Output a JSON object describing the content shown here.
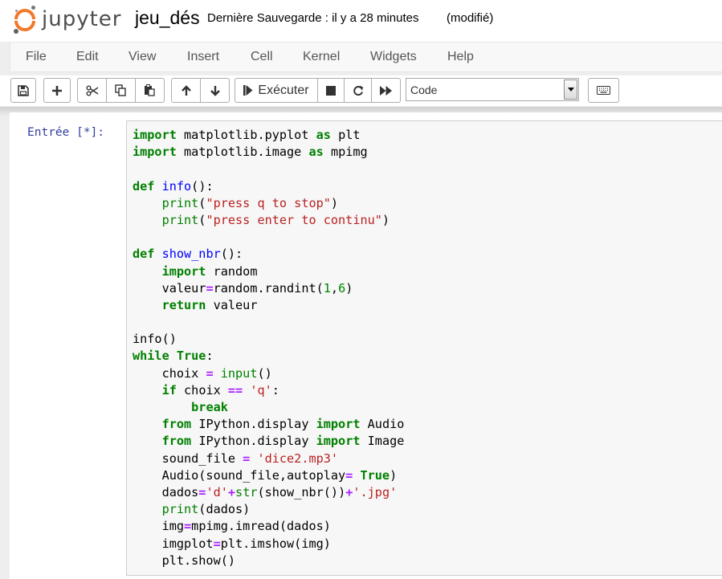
{
  "header": {
    "logo_text": "jupyter",
    "notebook_name": "jeu_dés",
    "save_status": "Dernière Sauvegarde : il y a 28 minutes",
    "dirty_indicator": "(modifié)"
  },
  "menu": [
    "File",
    "Edit",
    "View",
    "Insert",
    "Cell",
    "Kernel",
    "Widgets",
    "Help"
  ],
  "toolbar": {
    "run_label": "Exécuter",
    "cell_type": "Code",
    "icons": [
      "save-icon",
      "plus-icon",
      "scissors-icon",
      "copy-icon",
      "paste-icon",
      "arrow-up-icon",
      "arrow-down-icon",
      "step-forward-icon",
      "stop-icon",
      "restart-icon",
      "fast-forward-icon",
      "keyboard-icon"
    ]
  },
  "cell": {
    "prompt": "Entrée [*]:",
    "lines": [
      [
        [
          "kw",
          "import"
        ],
        [
          "",
          "matplotlib.pyplot"
        ],
        [
          "kw",
          "as"
        ],
        [
          "",
          "plt"
        ]
      ],
      [
        [
          "kw",
          "import"
        ],
        [
          "",
          "matplotlib.image"
        ],
        [
          "kw",
          "as"
        ],
        [
          "",
          "mpimg"
        ]
      ],
      [],
      [
        [
          "kw",
          "def"
        ],
        [
          "fn",
          "info"
        ],
        [
          "",
          "():"
        ]
      ],
      [
        [
          "",
          "    "
        ],
        [
          "bi",
          "print"
        ],
        [
          "",
          "("
        ],
        [
          "st",
          "\"press q to stop\""
        ],
        [
          "",
          ")"
        ]
      ],
      [
        [
          "",
          "    "
        ],
        [
          "bi",
          "print"
        ],
        [
          "",
          "("
        ],
        [
          "st",
          "\"press enter to continu\""
        ],
        [
          "",
          ")"
        ]
      ],
      [],
      [
        [
          "kw",
          "def"
        ],
        [
          "fn",
          "show_nbr"
        ],
        [
          "",
          "():"
        ]
      ],
      [
        [
          "",
          "    "
        ],
        [
          "kw",
          "import"
        ],
        [
          "",
          "random"
        ]
      ],
      [
        [
          "",
          "    valeur"
        ],
        [
          "op",
          "="
        ],
        [
          "",
          "random.randint("
        ],
        [
          "nm",
          "1"
        ],
        [
          "",
          ","
        ],
        [
          "nm",
          "6"
        ],
        [
          "",
          ")"
        ]
      ],
      [
        [
          "",
          "    "
        ],
        [
          "kw",
          "return"
        ],
        [
          "",
          "valeur"
        ]
      ],
      [],
      [
        [
          "",
          "info()"
        ]
      ],
      [
        [
          "kw",
          "while"
        ],
        [
          "kw",
          "True"
        ],
        [
          "",
          ":"
        ]
      ],
      [
        [
          "",
          "    choix "
        ],
        [
          "op",
          "="
        ],
        [
          "bi",
          "input"
        ],
        [
          "",
          "()"
        ]
      ],
      [
        [
          "",
          "    "
        ],
        [
          "kw",
          "if"
        ],
        [
          "",
          "choix "
        ],
        [
          "op",
          "=="
        ],
        [
          "st",
          "'q'"
        ],
        [
          "",
          ":"
        ]
      ],
      [
        [
          "",
          "        "
        ],
        [
          "kw",
          "break"
        ]
      ],
      [
        [
          "",
          "    "
        ],
        [
          "kw",
          "from"
        ],
        [
          "",
          "IPython.display"
        ],
        [
          "kw",
          "import"
        ],
        [
          "",
          "Audio"
        ]
      ],
      [
        [
          "",
          "    "
        ],
        [
          "kw",
          "from"
        ],
        [
          "",
          "IPython.display"
        ],
        [
          "kw",
          "import"
        ],
        [
          "",
          "Image"
        ]
      ],
      [
        [
          "",
          "    sound_file "
        ],
        [
          "op",
          "="
        ],
        [
          "st",
          "'dice2.mp3'"
        ]
      ],
      [
        [
          "",
          "    Audio(sound_file,autoplay"
        ],
        [
          "op",
          "="
        ],
        [
          "kw",
          "True"
        ],
        [
          "",
          ")"
        ]
      ],
      [
        [
          "",
          "    dados"
        ],
        [
          "op",
          "="
        ],
        [
          "st",
          "'d'"
        ],
        [
          "op",
          "+"
        ],
        [
          "bi",
          "str"
        ],
        [
          "",
          "(show_nbr())"
        ],
        [
          "op",
          "+"
        ],
        [
          "st",
          "'.jpg'"
        ]
      ],
      [
        [
          "",
          "    "
        ],
        [
          "bi",
          "print"
        ],
        [
          "",
          "(dados)"
        ]
      ],
      [
        [
          "",
          "    img"
        ],
        [
          "op",
          "="
        ],
        [
          "",
          "mpimg.imread(dados)"
        ]
      ],
      [
        [
          "",
          "    imgplot"
        ],
        [
          "op",
          "="
        ],
        [
          "",
          "plt.imshow(img)"
        ]
      ],
      [
        [
          "",
          "    plt.show()"
        ]
      ]
    ]
  }
}
